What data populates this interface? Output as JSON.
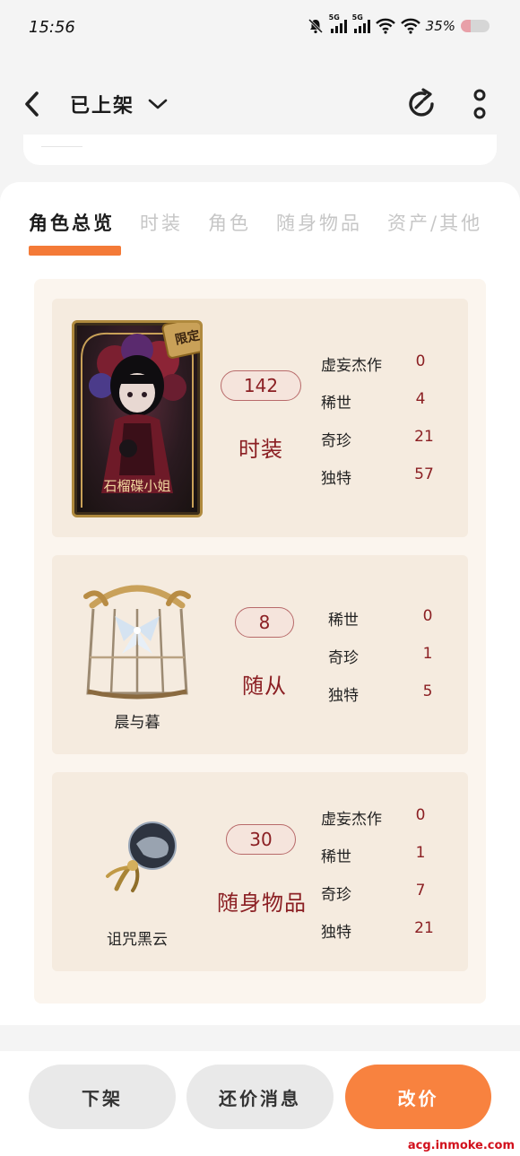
{
  "status_bar": {
    "time": "15:56",
    "signal1": "5G",
    "signal2": "5G",
    "battery": "35%"
  },
  "header": {
    "title": "已上架"
  },
  "tabs": [
    "角色总览",
    "时装",
    "角色",
    "随身物品",
    "资产/其他"
  ],
  "cards": [
    {
      "thumb_name": "石榴碟小姐",
      "badge": "限定",
      "count": "142",
      "category": "时装",
      "rarities": [
        {
          "label": "虚妄杰作",
          "value": "0"
        },
        {
          "label": "稀世",
          "value": "4"
        },
        {
          "label": "奇珍",
          "value": "21"
        },
        {
          "label": "独特",
          "value": "57"
        }
      ]
    },
    {
      "thumb_name": "晨与暮",
      "count": "8",
      "category": "随从",
      "rarities": [
        {
          "label": "稀世",
          "value": "0"
        },
        {
          "label": "奇珍",
          "value": "1"
        },
        {
          "label": "独特",
          "value": "5"
        }
      ]
    },
    {
      "thumb_name": "诅咒黑云",
      "count": "30",
      "category": "随身物品",
      "rarities": [
        {
          "label": "虚妄杰作",
          "value": "0"
        },
        {
          "label": "稀世",
          "value": "1"
        },
        {
          "label": "奇珍",
          "value": "7"
        },
        {
          "label": "独特",
          "value": "21"
        }
      ]
    }
  ],
  "actions": {
    "delist": "下架",
    "counter_offers": "还价消息",
    "change_price": "改价"
  },
  "watermark": "acg.inmoke.com",
  "colors": {
    "accent": "#f8823f",
    "category_red": "#8b1f23",
    "card_bg": "#f5ebdf"
  }
}
